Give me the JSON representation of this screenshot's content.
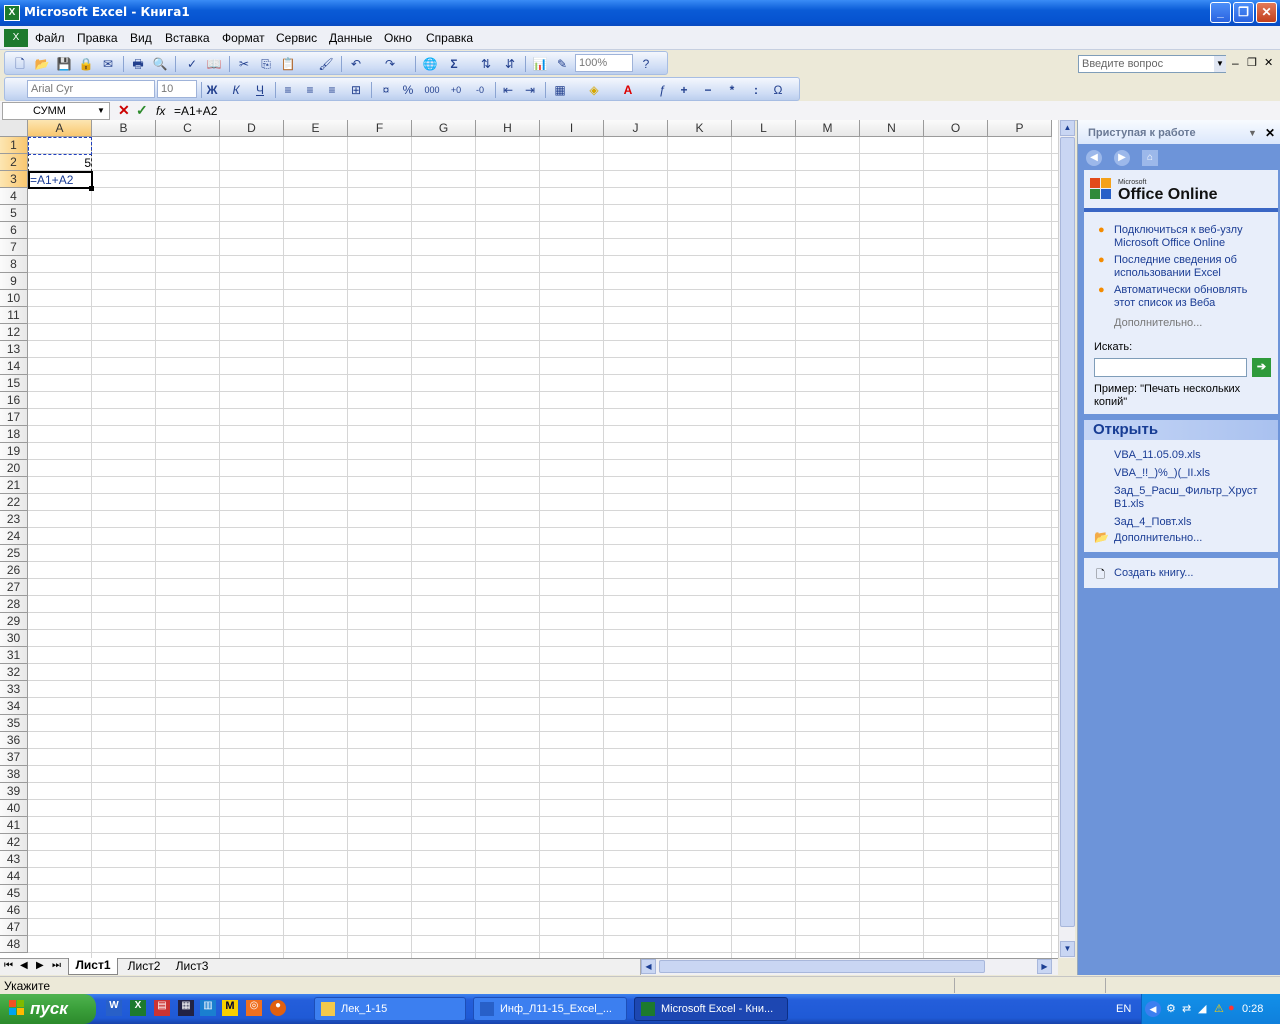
{
  "window": {
    "title": "Microsoft Excel - Книга1"
  },
  "menu": {
    "items": [
      "Файл",
      "Правка",
      "Вид",
      "Вставка",
      "Формат",
      "Сервис",
      "Данные",
      "Окно",
      "Справка"
    ],
    "help_placeholder": "Введите вопрос"
  },
  "toolbar": {
    "zoom": "100%",
    "font": "Arial Cyr",
    "size": "10",
    "bold": "Ж",
    "italic": "К",
    "underline": "Ч"
  },
  "formula_bar": {
    "namebox": "СУММ",
    "fx": "fx",
    "formula": "=A1+A2"
  },
  "grid": {
    "columns": [
      "A",
      "B",
      "C",
      "D",
      "E",
      "F",
      "G",
      "H",
      "I",
      "J",
      "K",
      "L",
      "M",
      "N",
      "O",
      "P"
    ],
    "rows": [
      "1",
      "2",
      "3",
      "4",
      "5",
      "6",
      "7",
      "8",
      "9",
      "10",
      "11",
      "12",
      "13",
      "14",
      "15",
      "16",
      "17",
      "18",
      "19",
      "20",
      "21",
      "22",
      "23",
      "24",
      "25",
      "26",
      "27",
      "28",
      "29",
      "30",
      "31",
      "32",
      "33",
      "34",
      "35",
      "36",
      "37",
      "38",
      "39",
      "40",
      "41",
      "42",
      "43",
      "44",
      "45",
      "46",
      "47",
      "48"
    ],
    "cells": {
      "A2": "5",
      "A3": "=A1+A2"
    }
  },
  "sheets": {
    "tabs": [
      "Лист1",
      "Лист2",
      "Лист3"
    ],
    "active": "Лист1"
  },
  "status": {
    "text": "Укажите"
  },
  "taskpane": {
    "title": "Приступая к работе",
    "brand_small": "Microsoft",
    "brand": "Office Online",
    "links": [
      "Подключиться к веб-узлу Microsoft Office Online",
      "Последние сведения об использовании Excel",
      "Автоматически обновлять этот список из Веба"
    ],
    "more1": "Дополнительно...",
    "search_label": "Искать:",
    "example": "Пример:  \"Печать нескольких копий\"",
    "open_title": "Открыть",
    "files": [
      "VBA_11.05.09.xls",
      "VBA_!!_)%_)(_II.xls",
      "Зад_5_Расш_Фильтр_Хруст B1.xls",
      "Зад_4_Повт.xls"
    ],
    "more2": "Дополнительно...",
    "create": "Создать книгу..."
  },
  "taskbar": {
    "start": "пуск",
    "buttons": [
      "Лек_1-15",
      "Инф_Л11-15_Excel_...",
      "Microsoft Excel - Кни..."
    ],
    "lang": "EN",
    "clock": "0:28"
  },
  "colors": {
    "title": "#0a5bd6",
    "taskpane": "#6d94d9",
    "selected_header": "#f9c770"
  }
}
